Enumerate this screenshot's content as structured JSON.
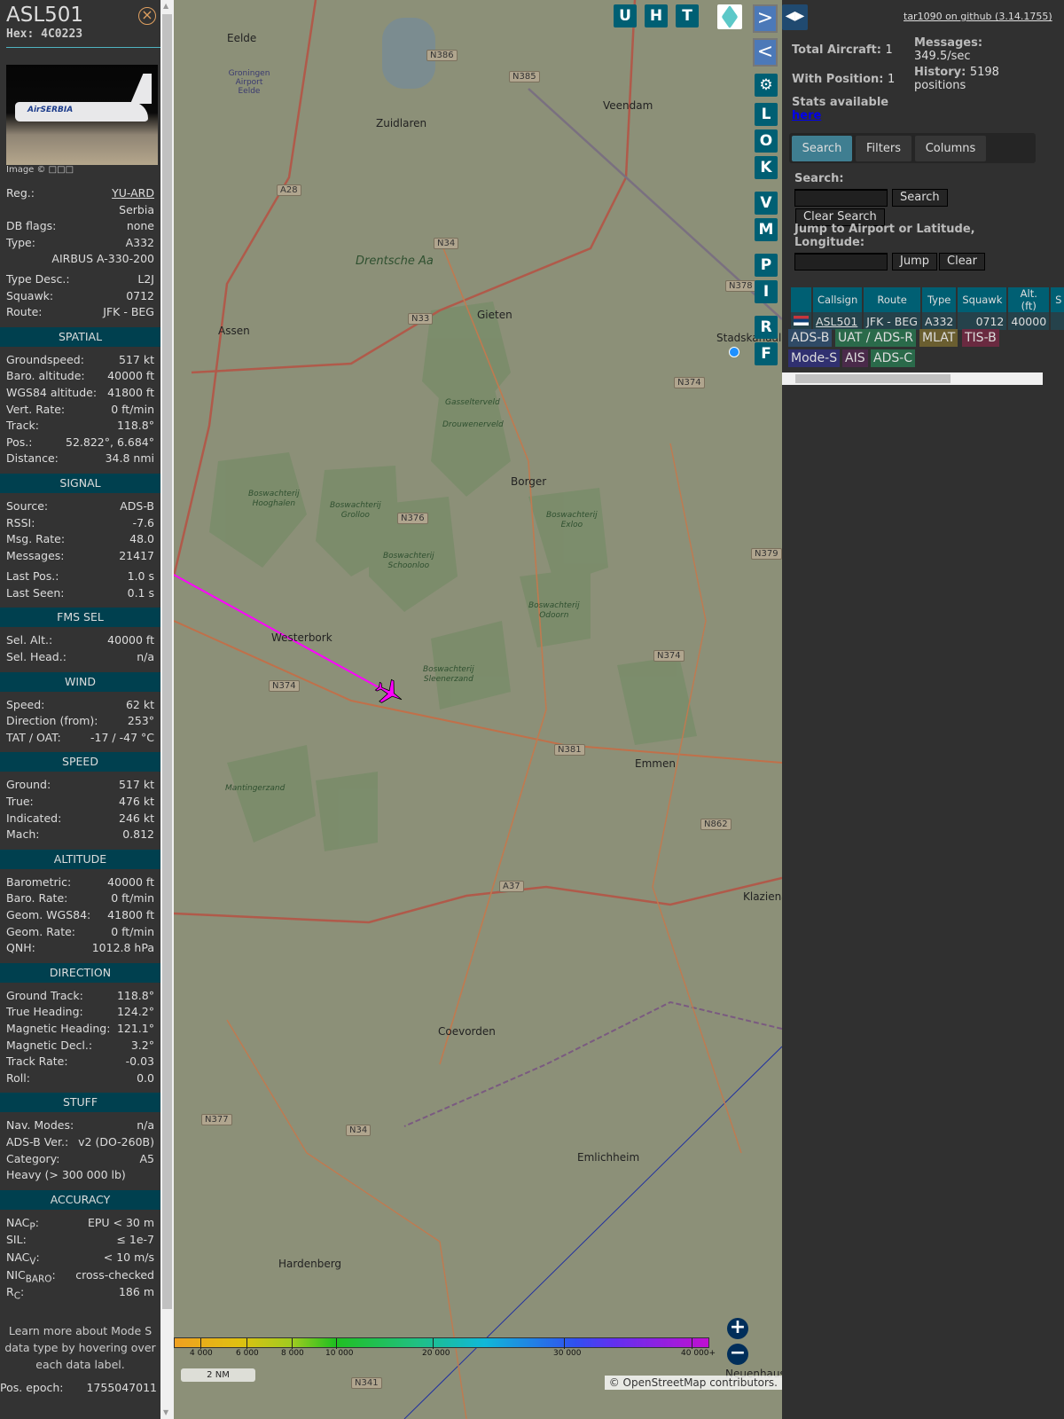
{
  "aircraft": {
    "callsign": "ASL501",
    "hex": "Hex: 4C0223",
    "image_credit": "Image © □□□",
    "image_livery": "AirSERBIA"
  },
  "info_rows": [
    {
      "label": "Reg.:",
      "value": "YU-ARD",
      "link": true
    },
    {
      "label": "",
      "value": "Serbia"
    },
    {
      "label": "DB flags:",
      "value": "none"
    },
    {
      "label": "Type:",
      "value": "A332"
    },
    {
      "label": "",
      "value": "AIRBUS A-330-200"
    },
    {
      "label": "Type Desc.:",
      "value": "L2J"
    },
    {
      "label": "Squawk:",
      "value": "0712"
    },
    {
      "label": "Route:",
      "value": "JFK - BEG"
    }
  ],
  "sections": [
    {
      "title": "SPATIAL",
      "rows": [
        [
          "Groundspeed:",
          "517 kt"
        ],
        [
          "Baro. altitude:",
          "40000 ft"
        ],
        [
          "WGS84 altitude:",
          "41800 ft"
        ],
        [
          "Vert. Rate:",
          "0 ft/min"
        ],
        [
          "Track:",
          "118.8°"
        ],
        [
          "Pos.:",
          "52.822°, 6.684°"
        ],
        [
          "Distance:",
          "34.8 nmi"
        ]
      ]
    },
    {
      "title": "SIGNAL",
      "rows": [
        [
          "Source:",
          "ADS-B"
        ],
        [
          "RSSI:",
          "-7.6"
        ],
        [
          "Msg. Rate:",
          "48.0"
        ],
        [
          "Messages:",
          "21417"
        ],
        [
          "Last Pos.:",
          "1.0 s"
        ],
        [
          "Last Seen:",
          "0.1 s"
        ]
      ]
    },
    {
      "title": "FMS SEL",
      "rows": [
        [
          "Sel. Alt.:",
          "40000 ft"
        ],
        [
          "Sel. Head.:",
          "n/a"
        ]
      ]
    },
    {
      "title": "WIND",
      "rows": [
        [
          "Speed:",
          "62 kt"
        ],
        [
          "Direction (from):",
          "253°"
        ],
        [
          "TAT / OAT:",
          "-17 / -47 °C"
        ]
      ]
    },
    {
      "title": "SPEED",
      "rows": [
        [
          "Ground:",
          "517 kt"
        ],
        [
          "True:",
          "476 kt"
        ],
        [
          "Indicated:",
          "246 kt"
        ],
        [
          "Mach:",
          "0.812"
        ]
      ]
    },
    {
      "title": "ALTITUDE",
      "rows": [
        [
          "Barometric:",
          "40000 ft"
        ],
        [
          "Baro. Rate:",
          "0 ft/min"
        ],
        [
          "Geom. WGS84:",
          "41800 ft"
        ],
        [
          "Geom. Rate:",
          "0 ft/min"
        ],
        [
          "QNH:",
          "1012.8 hPa"
        ]
      ]
    },
    {
      "title": "DIRECTION",
      "rows": [
        [
          "Ground Track:",
          "118.8°"
        ],
        [
          "True Heading:",
          "124.2°"
        ],
        [
          "Magnetic Heading:",
          "121.1°"
        ],
        [
          "Magnetic Decl.:",
          "3.2°"
        ],
        [
          "Track Rate:",
          "-0.03"
        ],
        [
          "Roll:",
          "0.0"
        ]
      ]
    },
    {
      "title": "STUFF",
      "rows": [
        [
          "Nav. Modes:",
          "n/a"
        ],
        [
          "ADS-B Ver.:",
          "v2 (DO-260B)"
        ],
        [
          "Category:",
          "A5"
        ],
        [
          "Heavy (> 300 000 lb)",
          ""
        ]
      ]
    },
    {
      "title": "ACCURACY",
      "rows": [
        [
          "NAC<sub>P</sub>:",
          "EPU < 30 m"
        ],
        [
          "SIL:",
          "≤ 1e-7"
        ],
        [
          "NAC<sub>V</sub>:",
          "< 10 m/s"
        ],
        [
          "NIC<sub>BARO</sub>:",
          "cross-checked"
        ],
        [
          "R<sub>C</sub>:",
          "186 m"
        ]
      ]
    }
  ],
  "note": "Learn more about Mode S data type by hovering over each data label.",
  "footer_row": {
    "label": "Pos. epoch:",
    "value": "1755047011"
  },
  "map_buttons": {
    "top": [
      "U",
      "H",
      "T"
    ],
    "side": [
      "L",
      "O",
      "K",
      "V",
      "M",
      "P",
      "I",
      "R",
      "F"
    ]
  },
  "stats": {
    "total": "Total Aircraft:",
    "total_v": "1",
    "withpos": "With Position:",
    "withpos_v": "1",
    "messages": "Messages:",
    "messages_v": "349.5/sec",
    "history": "History:",
    "history_v": "5198 positions",
    "stats_text": "Stats available",
    "stats_link": "here",
    "github": "tar1090 on github (3.14.1755)"
  },
  "tabs": [
    "Search",
    "Filters",
    "Columns"
  ],
  "search": {
    "label": "Search:",
    "button": "Search",
    "clear": "Clear Search",
    "jump_label": "Jump to Airport or Latitude, Longitude:",
    "jump": "Jump",
    "jump_clear": "Clear"
  },
  "table": {
    "headers": [
      "",
      "Callsign",
      "Route",
      "Type",
      "Squawk",
      "Alt. (ft)",
      "S"
    ],
    "rows": [
      [
        "",
        "ASL501",
        "JFK - BEG",
        "A332",
        "0712",
        "40000",
        ""
      ]
    ]
  },
  "badges": [
    {
      "t": "ADS-B",
      "c": "#2f4a66"
    },
    {
      "t": "UAT / ADS-R",
      "c": "#2a6a4a"
    },
    {
      "t": "MLAT",
      "c": "#6a5e30"
    },
    {
      "t": "TIS-B",
      "c": "#6a2a40"
    },
    {
      "t": "Mode-S",
      "c": "#303070"
    },
    {
      "t": "AIS",
      "c": "#4a2a4a"
    },
    {
      "t": "ADS-C",
      "c": "#2a6a4a"
    }
  ],
  "colorbar": [
    "4 000",
    "6 000",
    "8 000",
    "10 000",
    "20 000",
    "30 000",
    "40 000+"
  ],
  "scale": "2 NM",
  "attribution": "© OpenStreetMap contributors.",
  "places": [
    "Eelde",
    "Groningen Airport Eelde",
    "Zuidlaren",
    "Veendam",
    "Assen",
    "Gieten",
    "Stadskanaal",
    "Borger",
    "Westerbork",
    "Emmen",
    "Klazienaveen",
    "Coevorden",
    "Emlichheim",
    "Hardenberg",
    "Neuenhaus",
    "Drentsche Aa"
  ],
  "forests": [
    "Gasselterveld",
    "Drouwenerveld",
    "Boswachterij Hooghalen",
    "Boswachterij Grolloo",
    "Boswachterij Schoonloo",
    "Boswachterij Exloo",
    "Boswachterij Odoorn",
    "Boswachterij Sleenerzand",
    "Mantingerzand"
  ],
  "roads": [
    "N386",
    "N385",
    "A28",
    "N34",
    "N33",
    "N378",
    "N374",
    "N376",
    "N379",
    "N381",
    "N862",
    "A37",
    "N377",
    "N34",
    "N341",
    "N374",
    "N374"
  ],
  "colors": {
    "track": "#ff00ff",
    "header": "#00404f",
    "button": "#005f73"
  }
}
